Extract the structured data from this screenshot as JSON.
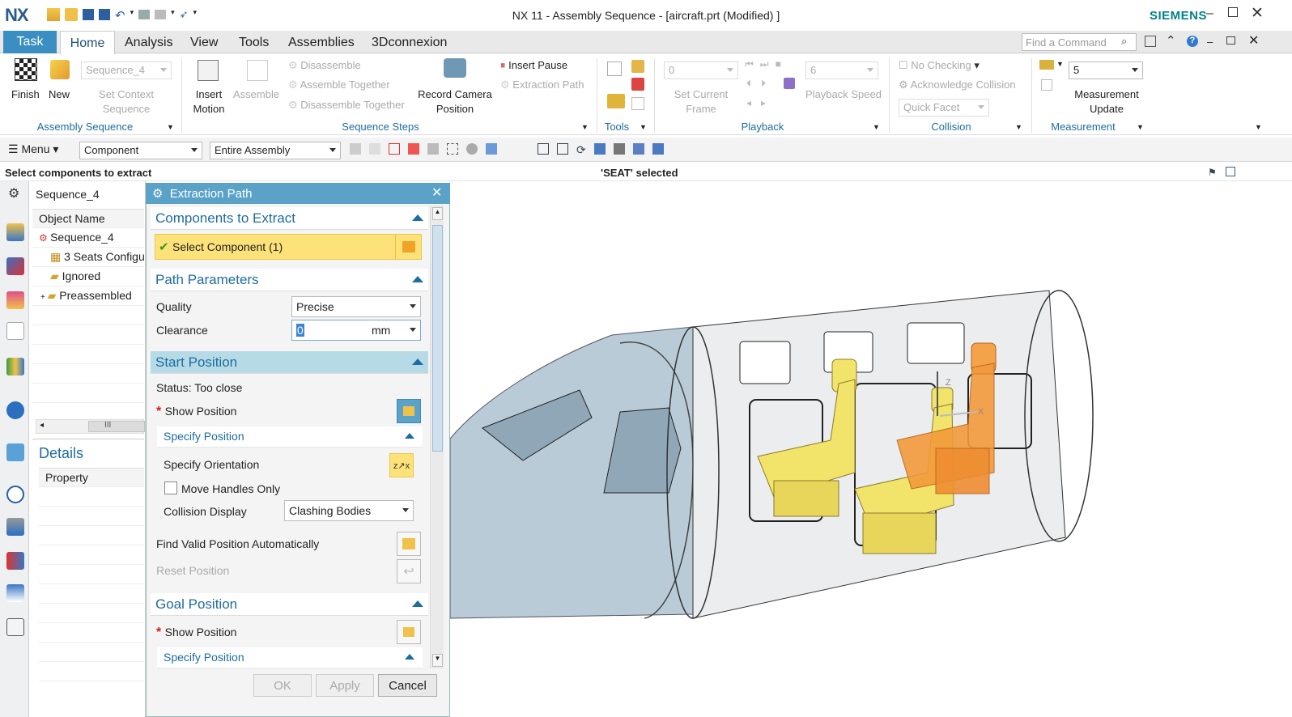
{
  "app": {
    "logo": "NX",
    "title": "NX 11 - Assembly Sequence - [aircraft.prt (Modified) ]",
    "brand": "SIEMENS"
  },
  "tabs": [
    "Task",
    "Home",
    "Analysis",
    "View",
    "Tools",
    "Assemblies",
    "3Dconnexion"
  ],
  "find_command": {
    "placeholder": "Find a Command"
  },
  "ribbon": {
    "finish": "Finish",
    "new": "New",
    "sequence_combo": "Sequence_4",
    "set_context": "Set Context Sequence",
    "assembly_sequence_group": "Assembly Sequence",
    "insert_motion": "Insert Motion",
    "assemble": "Assemble",
    "disassemble": "Disassemble",
    "assemble_together": "Assemble Together",
    "disassemble_together": "Disassemble Together",
    "record_camera": "Record Camera Position",
    "insert_pause": "Insert Pause",
    "extraction_path": "Extraction Path",
    "sequence_steps_group": "Sequence Steps",
    "tools_group": "Tools",
    "frame_value": "0",
    "set_current_frame": "Set Current Frame",
    "speed_value": "6",
    "playback_speed": "Playback Speed",
    "playback_group": "Playback",
    "no_checking": "No Checking",
    "acknowledge_collision": "Acknowledge Collision",
    "quick_facet": "Quick Facet",
    "collision_group": "Collision",
    "measurement_value": "5",
    "measurement_update": "Measurement Update",
    "measurement_group": "Measurement"
  },
  "toolbar2": {
    "menu": "Menu",
    "filter": "Component",
    "scope": "Entire Assembly"
  },
  "status": {
    "prompt": "Select components to extract",
    "selection": "'SEAT' selected"
  },
  "navigator": {
    "title": "Sequence_4",
    "column": "Object Name",
    "items": [
      "Sequence_4",
      "3 Seats Configu",
      "Ignored",
      "Preassembled"
    ],
    "scroll_mark": "III",
    "details_title": "Details",
    "details_column": "Property"
  },
  "dialog": {
    "title": "Extraction Path",
    "components_section": "Components to Extract",
    "select_component": "Select Component (1)",
    "path_section": "Path Parameters",
    "quality_label": "Quality",
    "quality_value": "Precise",
    "clearance_label": "Clearance",
    "clearance_value": "0",
    "clearance_unit": "mm",
    "start_section": "Start Position",
    "status_label": "Status: Too close",
    "show_position": "Show Position",
    "specify_position": "Specify Position",
    "specify_orientation": "Specify Orientation",
    "move_handles_only": "Move Handles Only",
    "collision_display_label": "Collision Display",
    "collision_display_value": "Clashing Bodies",
    "find_valid": "Find Valid Position Automatically",
    "reset_position": "Reset Position",
    "goal_section": "Goal Position",
    "goal_show_position": "Show Position",
    "goal_specify_position": "Specify Position",
    "ok": "OK",
    "apply": "Apply",
    "cancel": "Cancel"
  },
  "colors": {
    "accent": "#3b8ec2",
    "dialog_title": "#5aa2c8",
    "selection": "#fde27a",
    "seat_yellow": "#f2e36a",
    "seat_orange": "#f39a3b"
  }
}
